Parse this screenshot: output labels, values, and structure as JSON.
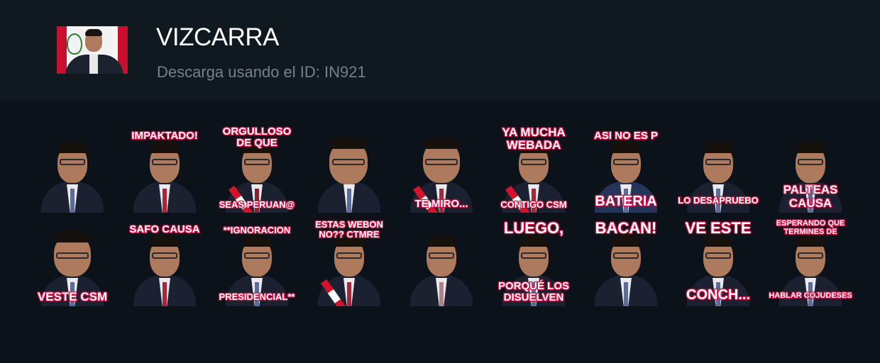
{
  "pack": {
    "title": "VIZCARRA",
    "subtitle": "Descarga usando el ID: IN921"
  },
  "stickers": [
    {
      "top": "",
      "bottom": ""
    },
    {
      "top": "IMPAKTADO!",
      "bottom": ""
    },
    {
      "top": "ORGULLOSO\nDE QUE",
      "bottom": "SEAS PERUAN@"
    },
    {
      "top": "",
      "bottom": ""
    },
    {
      "top": "",
      "bottom": "TE MIRO..."
    },
    {
      "top": "YA MUCHA\nWEBADA",
      "bottom": "CONTIGO CSM"
    },
    {
      "top": "ASI NO ES P",
      "bottom": "BATERIA"
    },
    {
      "top": "",
      "bottom": "LO DESAPRUEBO"
    },
    {
      "top": "",
      "bottom": "PALTEAS\nCAUSA"
    },
    {
      "top": "",
      "bottom": "VESTE  CSM"
    },
    {
      "top": "SAFO CAUSA",
      "bottom": ""
    },
    {
      "top": "**IGNORACION",
      "bottom": "PRESIDENCIAL**"
    },
    {
      "top": "ESTAS WEBON\nNO?? CTMRE",
      "bottom": ""
    },
    {
      "top": "",
      "bottom": ""
    },
    {
      "top": "LUEGO,",
      "bottom": "PORQUÉ LOS\nDISUELVEN"
    },
    {
      "top": "BACAN!",
      "bottom": ""
    },
    {
      "top": "VE ESTE",
      "bottom": "CONCH..."
    },
    {
      "top": "ESPERANDO QUE\nTERMINES DE",
      "bottom": "HABLAR COJUDESES"
    }
  ],
  "colors": {
    "background": "#0b121a",
    "header": "#111920",
    "caption_outline": "#e0134a"
  },
  "icons": {
    "pack_thumbnail": "portrait-thumbnail"
  }
}
